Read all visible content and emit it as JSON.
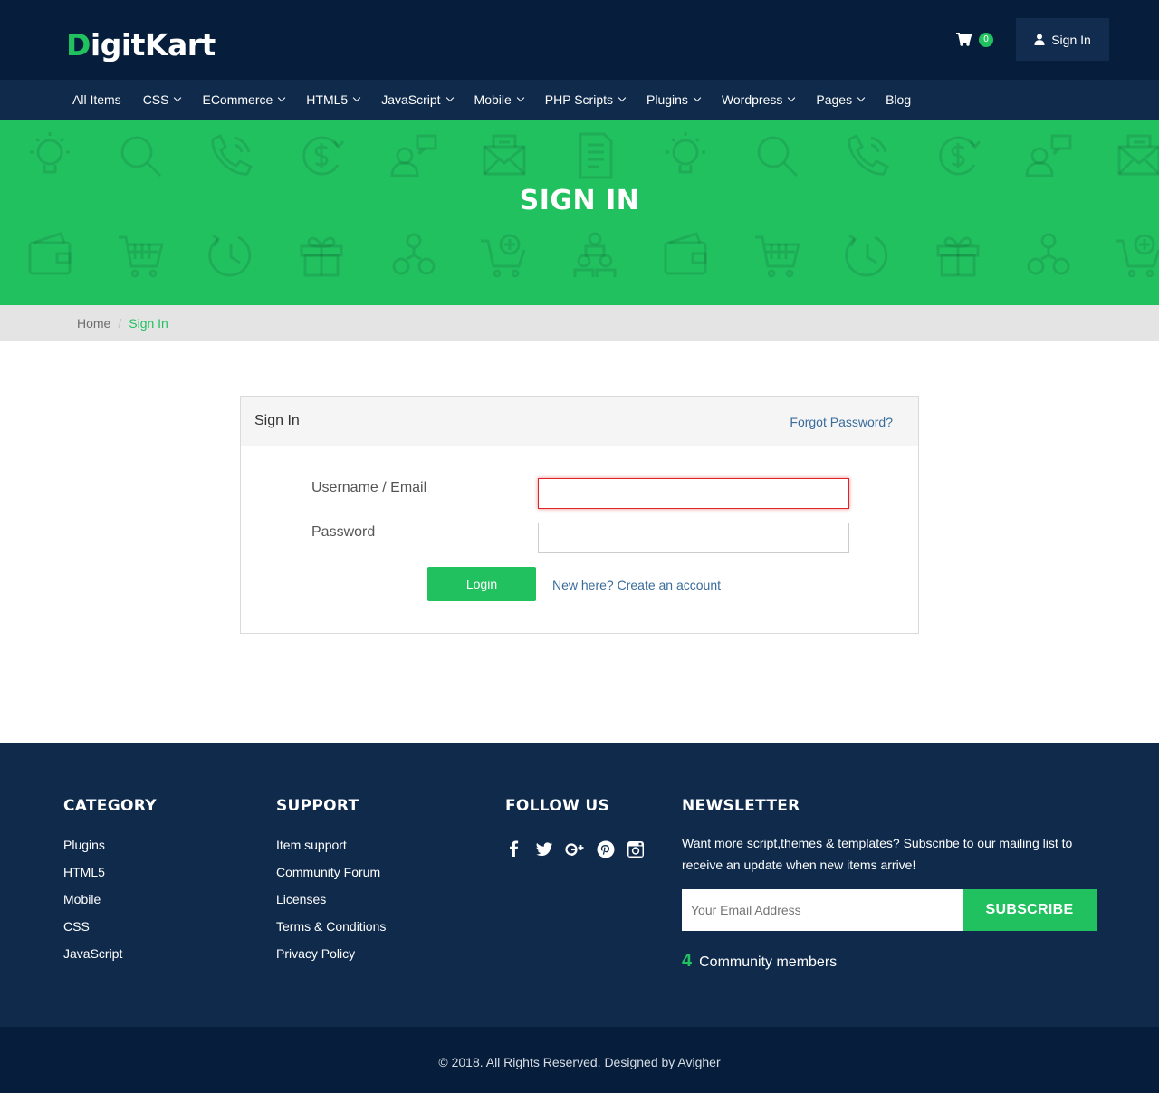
{
  "header": {
    "logo_first": "D",
    "logo_rest": "igitKart",
    "cart_count": "0",
    "cart_icon": "shopping-cart-icon",
    "signin_label": "Sign In",
    "user_icon": "user-icon"
  },
  "nav": [
    {
      "label": "All Items",
      "dropdown": false
    },
    {
      "label": "CSS",
      "dropdown": true
    },
    {
      "label": "ECommerce",
      "dropdown": true
    },
    {
      "label": "HTML5",
      "dropdown": true
    },
    {
      "label": "JavaScript",
      "dropdown": true
    },
    {
      "label": "Mobile",
      "dropdown": true
    },
    {
      "label": "PHP Scripts",
      "dropdown": true
    },
    {
      "label": "Plugins",
      "dropdown": true
    },
    {
      "label": "Wordpress",
      "dropdown": true
    },
    {
      "label": "Pages",
      "dropdown": true
    },
    {
      "label": "Blog",
      "dropdown": false
    }
  ],
  "banner": {
    "title": "SIGN IN"
  },
  "breadcrumb": {
    "home": "Home",
    "separator": "/",
    "current": "Sign In"
  },
  "signin_panel": {
    "title": "Sign In",
    "forgot_link": "Forgot Password?",
    "username_label": "Username / Email",
    "username_value": "",
    "password_label": "Password",
    "password_value": "",
    "login_button": "Login",
    "create_account_link": "New here? Create an account"
  },
  "footer": {
    "category": {
      "heading": "CATEGORY",
      "items": [
        "Plugins",
        "HTML5",
        "Mobile",
        "CSS",
        "JavaScript"
      ]
    },
    "support": {
      "heading": "SUPPORT",
      "items": [
        "Item support",
        "Community Forum",
        "Licenses",
        "Terms & Conditions",
        "Privacy Policy"
      ]
    },
    "follow": {
      "heading": "FOLLOW US",
      "icons": [
        "facebook-icon",
        "twitter-icon",
        "google-plus-icon",
        "pinterest-icon",
        "instagram-icon"
      ]
    },
    "newsletter": {
      "heading": "NEWSLETTER",
      "text": "Want more script,themes & templates? Subscribe to our mailing list to receive an update when new items arrive!",
      "email_placeholder": "Your Email Address",
      "subscribe_button": "SUBSCRIBE",
      "community_count": "4",
      "community_label": "Community members"
    },
    "copyright": "© 2018. All Rights Reserved. Designed by Avigher"
  },
  "colors": {
    "header_bg": "#061e3c",
    "nav_bg": "#0f2a4b",
    "accent_green": "#22c160",
    "link_blue": "#3a6c9b",
    "error_red": "#e02424"
  }
}
